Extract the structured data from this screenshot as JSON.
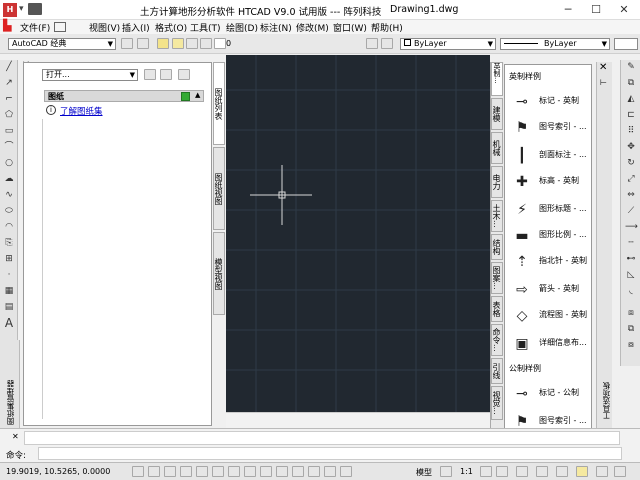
{
  "app": {
    "title": "土方计算地形分析软件 HTCAD V9.0 试用版 --- 阵列科技",
    "drawing": "Drawing1.dwg",
    "window_controls": [
      "minimize-icon",
      "maximize-icon",
      "close-icon"
    ]
  },
  "menu": [
    "文件(F)",
    "视图(V)",
    "插入(I)",
    "格式(O)",
    "工具(T)",
    "绘图(D)",
    "标注(N)",
    "修改(M)",
    "窗口(W)",
    "帮助(H)"
  ],
  "toolbar": {
    "workspace": "AutoCAD 经典",
    "layer": "0",
    "color": "ByLayer",
    "linetype": "ByLayer"
  },
  "sheet_panel": {
    "open_dropdown": "打开...",
    "section_title": "图纸",
    "link": "了解图纸集",
    "side_tabs": [
      "图纸列表",
      "图纸视图",
      "模型视图"
    ],
    "title": "图纸集管理器"
  },
  "tool_palette": {
    "title": "工具选项板",
    "tabs": [
      "英制...",
      "建模",
      "机械",
      "电力",
      "土木...",
      "结构",
      "图案...",
      "表格",
      "命令...",
      "引线",
      "视觉..."
    ],
    "section1": "英制样例",
    "items1": [
      "标记 - 英制",
      "图号索引 - ...",
      "剖面标注 - ...",
      "标高 - 英制",
      "图形标题 - ...",
      "图形比例 - ...",
      "指北针 - 英制",
      "箭头 - 英制",
      "流程图 - 英制",
      "详细信息布..."
    ],
    "section2": "公制样例",
    "items2": [
      "标记 - 公制",
      "图号索引 - ..."
    ]
  },
  "command": {
    "prompt": "命令:",
    "coords": "19.9019, 10.5265, 0.0000"
  },
  "status": {
    "model": "模型",
    "scale": "1:1"
  },
  "colors": {
    "canvas": "#212830",
    "grid": "#2e3a47",
    "link": "#0000cc"
  }
}
